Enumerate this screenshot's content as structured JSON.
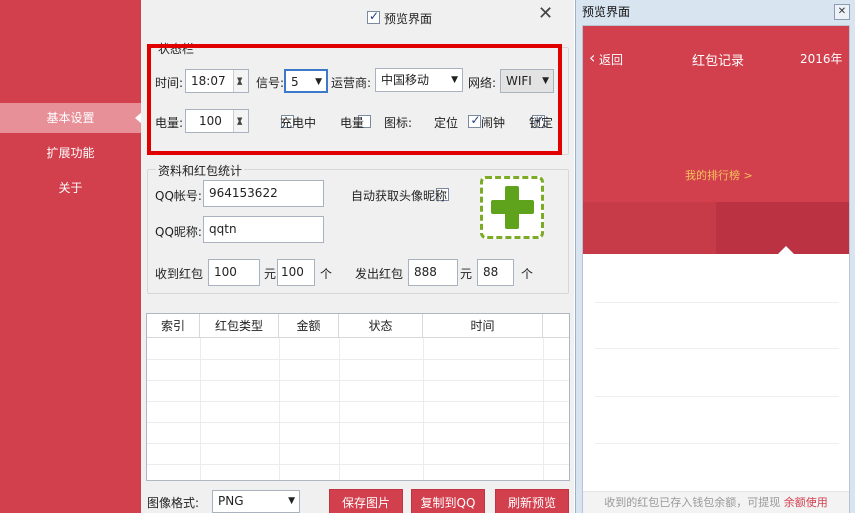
{
  "sidebar": {
    "items": [
      {
        "label": "基本设置"
      },
      {
        "label": "扩展功能"
      },
      {
        "label": "关于"
      }
    ]
  },
  "titlebar": {
    "preview_label": "预览界面"
  },
  "status_group": {
    "title": "状态栏",
    "time_label": "时间:",
    "time_value": "18:07",
    "signal_label": "信号:",
    "signal_value": "5",
    "carrier_label": "运营商:",
    "carrier_value": "中国移动",
    "network_label": "网络:",
    "network_value": "WIFI",
    "battery_label": "电量:",
    "battery_value": "100",
    "charging_label": "充电中",
    "battery_check_label": "电量",
    "icons_label": "图标:",
    "icon_location_label": "定位",
    "icon_alarm_label": "闹钟",
    "icon_lock_label": "锁定"
  },
  "profile_group": {
    "title": "资料和红包统计",
    "qq_label": "QQ帐号:",
    "qq_value": "964153622",
    "auto_label": "自动获取头像昵称",
    "nick_label": "QQ昵称:",
    "nick_value": "qqtn",
    "received_label": "收到红包",
    "received_amount": "100",
    "received_unit_yuan": "元",
    "received_count": "100",
    "received_unit_ge": "个",
    "sent_label": "发出红包",
    "sent_amount": "888",
    "sent_unit_yuan": "元",
    "sent_count": "88",
    "sent_unit_ge": "个"
  },
  "table": {
    "headers": [
      "索引",
      "红包类型",
      "金额",
      "状态",
      "时间"
    ]
  },
  "bottom": {
    "format_label": "图像格式:",
    "format_value": "PNG",
    "save_button": "保存图片",
    "copy_button": "复制到QQ",
    "refresh_button": "刷新预览"
  },
  "preview": {
    "window_title": "预览界面",
    "back_label": "返回",
    "title": "红包记录",
    "year": "2016年",
    "rank_link": "我的排行榜 >",
    "footer_text": "收到的红包已存入钱包余额，可提现",
    "footer_link": "余额使用"
  },
  "colors": {
    "brand_red": "#d23f4d",
    "highlight_red": "#e10000",
    "plus_green": "#5fa21c",
    "rank_link_color": "#f6c15b"
  }
}
